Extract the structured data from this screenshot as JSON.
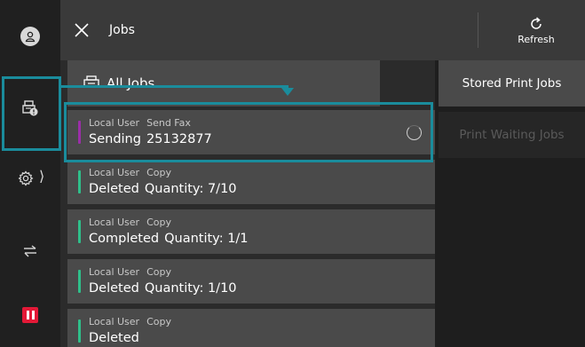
{
  "header": {
    "title": "Jobs",
    "refresh_label": "Refresh"
  },
  "rail": {
    "items": [
      {
        "icon": "user-icon"
      },
      {
        "icon": "print-jobs-alert-icon"
      },
      {
        "icon": "gear-icon"
      },
      {
        "icon": "transfer-icon"
      },
      {
        "icon": "pause-icon"
      }
    ]
  },
  "filter": {
    "label": "All Jobs",
    "icon": "printer-icon"
  },
  "jobs": [
    {
      "user": "Local User",
      "type": "Send Fax",
      "status": "Sending",
      "detail": "25132877",
      "color": "#9b2ea8"
    },
    {
      "user": "Local User",
      "type": "Copy",
      "status": "Deleted",
      "detail": "Quantity: 7/10",
      "color": "#2fbf8a"
    },
    {
      "user": "Local User",
      "type": "Copy",
      "status": "Completed",
      "detail": "Quantity: 1/1",
      "color": "#2fbf8a"
    },
    {
      "user": "Local User",
      "type": "Copy",
      "status": "Deleted",
      "detail": "Quantity: 1/10",
      "color": "#2fbf8a"
    },
    {
      "user": "Local User",
      "type": "Copy",
      "status": "Deleted",
      "detail": "",
      "color": "#2fbf8a"
    }
  ],
  "right_panel": {
    "stored_label": "Stored Print Jobs",
    "waiting_label": "Print Waiting Jobs"
  },
  "colors": {
    "highlight": "#1a8c9c",
    "fax_bar": "#9b2ea8",
    "copy_bar": "#2fbf8a",
    "pause": "#e31937"
  }
}
